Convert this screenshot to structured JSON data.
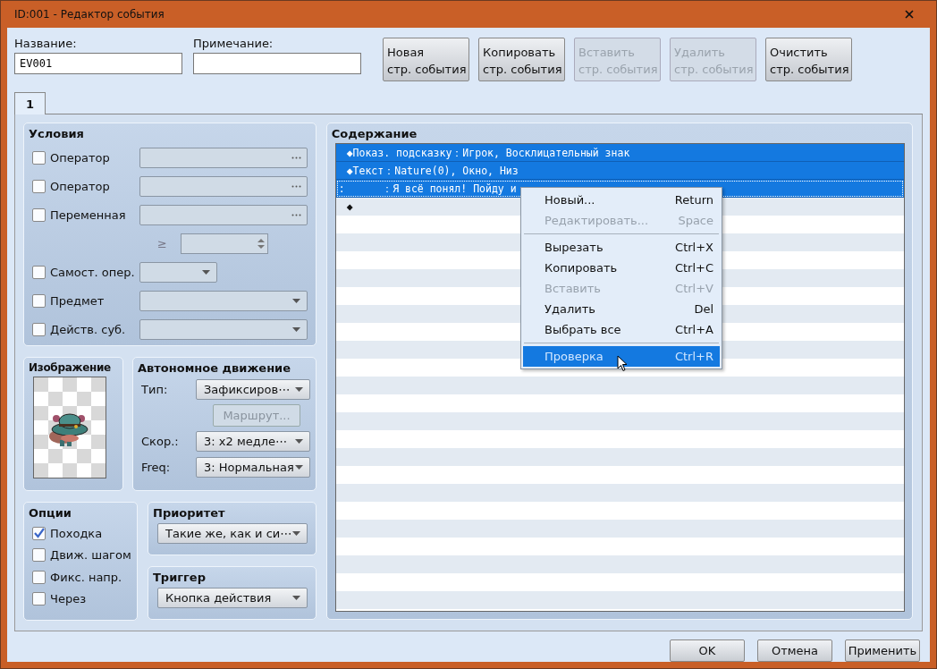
{
  "window": {
    "title": "ID:001 - Редактор события"
  },
  "name_field": {
    "label": "Название:",
    "value": "EV001"
  },
  "note_field": {
    "label": "Примечание:"
  },
  "page_buttons": [
    {
      "line1": "Новая",
      "line2": "стр. события",
      "disabled": false
    },
    {
      "line1": "Копировать",
      "line2": "стр. события",
      "disabled": false
    },
    {
      "line1": "Вставить",
      "line2": "стр. события",
      "disabled": true
    },
    {
      "line1": "Удалить",
      "line2": "стр. события",
      "disabled": true
    },
    {
      "line1": "Очистить",
      "line2": "стр. события",
      "disabled": false
    }
  ],
  "tabs": [
    {
      "label": "1",
      "selected": true
    }
  ],
  "conditions": {
    "title": "Условия",
    "rows": [
      {
        "kind": "picker",
        "label": "Оператор",
        "checked": false
      },
      {
        "kind": "picker",
        "label": "Оператор",
        "checked": false
      },
      {
        "kind": "picker",
        "label": "Переменная",
        "checked": false
      },
      {
        "kind": "compare",
        "sign": "≥"
      },
      {
        "kind": "short-select",
        "label": "Самост. опер.",
        "checked": false
      },
      {
        "kind": "select",
        "label": "Предмет",
        "checked": false
      },
      {
        "kind": "select",
        "label": "Действ. суб.",
        "checked": false
      }
    ]
  },
  "image": {
    "title": "Изображение"
  },
  "movement": {
    "title": "Автономное движение",
    "rows": [
      {
        "kind": "select",
        "label": "Тип:",
        "value": "Зафиксиров⋯"
      },
      {
        "kind": "button",
        "label": "Маршрут...",
        "disabled": true
      },
      {
        "kind": "select",
        "label": "Скор.:",
        "value": "3: x2 медле⋯"
      },
      {
        "kind": "select",
        "label": "Freq:",
        "value": "3: Нормальная"
      }
    ]
  },
  "options": {
    "title": "Опции",
    "items": [
      {
        "label": "Походка",
        "checked": true
      },
      {
        "label": "Движ. шагом",
        "checked": false
      },
      {
        "label": "Фикс. напр.",
        "checked": false
      },
      {
        "label": "Через",
        "checked": false
      }
    ]
  },
  "priority": {
    "title": "Приоритет",
    "value": "Такие же, как и си⋯"
  },
  "trigger": {
    "title": "Триггер",
    "value": "Кнопка действия"
  },
  "contents": {
    "title": "Содержание",
    "commands": [
      {
        "marker": "◆",
        "command": "Показ. подсказку",
        "separator": "：",
        "args": "Игрок, Восклицательный знак",
        "selected": true,
        "focused": false
      },
      {
        "marker": "◆",
        "command": "Текст",
        "separator": "：",
        "args": "Nature(0), Окно, Низ",
        "selected": true,
        "focused": false
      },
      {
        "marker": ":",
        "separator": "：",
        "args": "Я всё понял! Пойду и",
        "selected": true,
        "focused": true
      },
      {
        "marker": "◆",
        "selected": false,
        "focused": false
      }
    ]
  },
  "context_menu": {
    "items": [
      {
        "kind": "item",
        "label": "Новый...",
        "shortcut": "Return",
        "disabled": false,
        "selected": false
      },
      {
        "kind": "item",
        "label": "Редактировать...",
        "shortcut": "Space",
        "disabled": true,
        "selected": false
      },
      {
        "kind": "separator"
      },
      {
        "kind": "item",
        "label": "Вырезать",
        "shortcut": "Ctrl+X",
        "disabled": false,
        "selected": false
      },
      {
        "kind": "item",
        "label": "Копировать",
        "shortcut": "Ctrl+C",
        "disabled": false,
        "selected": false
      },
      {
        "kind": "item",
        "label": "Вставить",
        "shortcut": "Ctrl+V",
        "disabled": true,
        "selected": false
      },
      {
        "kind": "item",
        "label": "Удалить",
        "shortcut": "Del",
        "disabled": false,
        "selected": false
      },
      {
        "kind": "item",
        "label": "Выбрать все",
        "shortcut": "Ctrl+A",
        "disabled": false,
        "selected": false
      },
      {
        "kind": "separator"
      },
      {
        "kind": "item",
        "label": "Проверка",
        "shortcut": "Ctrl+R",
        "disabled": false,
        "selected": true
      }
    ]
  },
  "footer_buttons": [
    "OK",
    "Отмена",
    "Применить"
  ]
}
